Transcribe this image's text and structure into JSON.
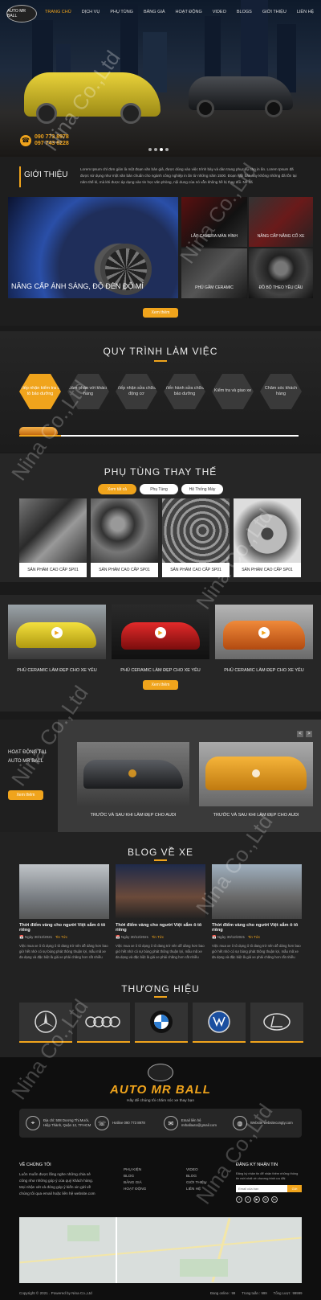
{
  "header": {
    "logo_text": "AUTO MR BALL",
    "nav": [
      "TRANG CHỦ",
      "DỊCH VỤ",
      "PHỤ TÙNG",
      "BẢNG GIÁ",
      "HOẠT ĐỘNG",
      "VIDEO",
      "BLOGS",
      "GIỚI THIỆU",
      "LIÊN HỆ"
    ],
    "hotline": [
      "090 773 8978",
      "097 743 6228"
    ]
  },
  "intro": {
    "title": "GIỚI THIỆU",
    "text": "Lorem Ipsum chỉ đơn giản là một đoạn văn bản giả, được dùng vào việc trình bày và dàn trang phục vụ cho in ấn. Lorem Ipsum đã được sử dụng như một văn bản chuẩn cho ngành công nghiệp in ấn từ những năm 1500. Đoạn văn bản này không những đã tồn tại năm thế kỉ, mà khi được áp dụng vào tin học văn phòng, nội dung của nó vẫn không hề bị thay đổi. Nó đã",
    "big_caption": "NÂNG CẤP ÁNH SÁNG, ĐỘ ĐÈN ĐỘ MÍ",
    "small_captions": [
      "LẮP CAMERA MÀN HÌNH",
      "NÂNG CẤP NÂNG CỐ XE",
      "PHỦ GẦM CERAMIC",
      "ĐỒ BỘ THEO YÊU CẦU"
    ],
    "button": "Xem thêm"
  },
  "process": {
    "title": "QUY TRÌNH LÀM VIỆC",
    "steps": [
      "Tiếp nhận kiểm tra ô tô bảo dưỡng",
      "Đàm phán với khách hàng",
      "Tiếp nhận sửa chữa động cơ",
      "Tiến hành sửa chữa bảo dưỡng",
      "Kiểm tra và giao xe",
      "Chăm sóc khách hàng"
    ]
  },
  "parts": {
    "title": "PHỤ TÙNG THAY THẾ",
    "tabs": [
      "Xem tất cả",
      "Phụ Tùng",
      "Hệ Thống Máy"
    ],
    "items": [
      "SẢN PHẨM CAO CẤP SP01",
      "SẢN PHẨM CAO CẤP SP01",
      "SẢN PHẨM CAO CẤP SP01",
      "SẢN PHẨM CAO CẤP SP01"
    ]
  },
  "videos": {
    "items": [
      "PHỦ CERAMIC LÀM ĐẸP CHO XE YÊU",
      "PHỦ CERAMIC LÀM ĐẸP CHO XE YÊU",
      "PHỦ CERAMIC LÀM ĐẸP CHO XE YÊU"
    ],
    "button": "Xem thêm"
  },
  "activity": {
    "title_l1": "HOẠT ĐỘNG TẠI",
    "title_l2": "AUTO MR BALL",
    "button": "Xem thêm",
    "items": [
      "TRƯỚC VÀ SAU KHI LÀM ĐẸP CHO AUDI",
      "TRƯỚC VÀ SAU KHI LÀM ĐẸP CHO AUDI"
    ],
    "arrows": [
      "<",
      ">"
    ]
  },
  "blog": {
    "title": "BLOG VỀ XE",
    "posts": [
      {
        "title": "Thời điểm vàng cho người Việt sắm ô tô riêng",
        "date": "Ngày 30/12/2021",
        "tag": "Tin Tức",
        "desc": "Việc mua xe ô tô dụng ô tô đang trở nên dễ dàng hơn bao giờ hết nhờ có sự bùng phát thông thuận lợi, mẫu mã xe đa dạng và đặc biệt là giá xe phải chăng hơn rất nhiều"
      },
      {
        "title": "Thời điểm vàng cho người Việt sắm ô tô riêng",
        "date": "Ngày 30/12/2021",
        "tag": "Tin Tức",
        "desc": "Việc mua xe ô tô dụng ô tô đang trở nên dễ dàng hơn bao giờ hết nhờ có sự bùng phát thông thuận lợi, mẫu mã xe đa dạng và đặc biệt là giá xe phải chăng hơn rất nhiều"
      },
      {
        "title": "Thời điểm vàng cho người Việt sắm ô tô riêng",
        "date": "Ngày 30/12/2021",
        "tag": "Tin Tức",
        "desc": "Việc mua xe ô tô dụng ô tô đang trở nên dễ dàng hơn bao giờ hết nhờ có sự bùng phát thông thuận lợi, mẫu mã xe đa dạng và đặc biệt là giá xe phải chăng hơn rất nhiều"
      }
    ]
  },
  "brands": {
    "title": "THƯƠNG HIỆU",
    "names": [
      "mercedes-logo",
      "audi-logo",
      "bmw-logo",
      "volkswagen-logo",
      "lexus-logo"
    ]
  },
  "footer": {
    "brand": "AUTO MR BALL",
    "slogan": "Hãy để chúng tôi chăm sóc xe thay bạn",
    "info": [
      {
        "icon": "location-icon",
        "label": "Địa chỉ: 508 Dương Thị Mười, Hiệp Thành, Quận 12, TP.HCM"
      },
      {
        "icon": "phone-icon",
        "label": "Hotline 090 773 8978"
      },
      {
        "icon": "mail-icon",
        "label": "Email liên hệ mrballauto@gmail.com"
      },
      {
        "icon": "globe-icon",
        "label": "Website websitecongty.com"
      }
    ],
    "about_title": "VỀ CHÚNG TÔI",
    "about_text": "Luôn muốn được lắng nghe những chia sẻ cũng như những góp ý của quý khách hàng. Mọi nhận xét và đóng góp ý kiến xin gửi về chúng tôi qua email hoặc liên hệ website.com",
    "col1": [
      "PHỤ KIỆN",
      "BLOG",
      "BẢNG GIÁ",
      "HOẠT ĐỘNG"
    ],
    "col2": [
      "VIDEO",
      "BLOG",
      "GIỚI THIỆU",
      "LIÊN HỆ"
    ],
    "newsletter_title": "ĐĂNG KÝ NHẬN TIN",
    "newsletter_text": "Đăng ký nhận tin để nhận thêm những thông tin mới nhất về chương trình ưu đãi",
    "newsletter_placeholder": "Email của bạn",
    "newsletter_button": "Gửi",
    "copyright": "Copyright © 2021 . Powered by Nina Co.,Ltd",
    "stats": [
      "Đang online : 99",
      "Trong tuần : 999",
      "Tổng Lượt : 99999"
    ]
  },
  "watermark": "Nina Co.,Ltd",
  "colors": {
    "accent": "#f0a41c",
    "dark": "#1a1a1a"
  }
}
